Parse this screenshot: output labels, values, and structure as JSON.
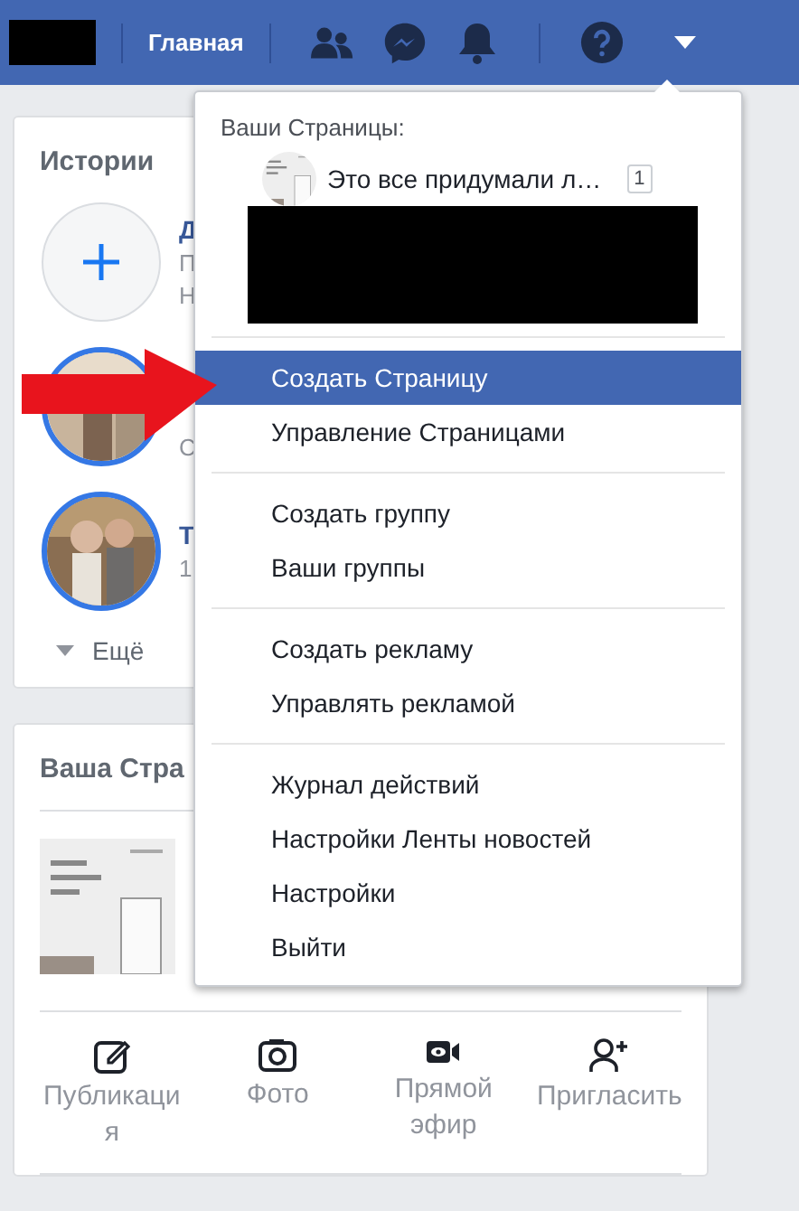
{
  "top_bar": {
    "home": "Главная",
    "menu_open": true
  },
  "stories": {
    "title": "Истории",
    "items": [
      {
        "kind": "add",
        "title": "Д",
        "lines": [
          "П",
          "Н"
        ]
      },
      {
        "kind": "story",
        "lines": [
          "С"
        ]
      },
      {
        "kind": "story",
        "title": "Т",
        "lines": [
          "1"
        ]
      }
    ],
    "more": "Ещё"
  },
  "your_page": {
    "title": "Ваша Стра",
    "actions": [
      {
        "kind": "post",
        "label": "Публикация"
      },
      {
        "label": "Фото"
      },
      {
        "kind": "live",
        "label": "Прямой эфир"
      },
      {
        "kind": "invite",
        "label": "Пригласить"
      }
    ]
  },
  "dropdown": {
    "header": "Ваши Страницы:",
    "page": {
      "name": "Это все придумали л…",
      "badge": "1"
    },
    "sections": [
      {
        "items": [
          {
            "label": "Создать Страницу",
            "selected": true
          },
          {
            "label": "Управление Страницами",
            "selected": false
          }
        ]
      },
      {
        "items": [
          {
            "label": "Создать группу",
            "selected": false
          },
          {
            "label": "Ваши группы",
            "selected": false
          }
        ]
      },
      {
        "items": [
          {
            "label": "Создать рекламу",
            "selected": false
          },
          {
            "label": "Управлять рекламой",
            "selected": false
          }
        ]
      },
      {
        "items": [
          {
            "label": "Журнал действий",
            "selected": false
          },
          {
            "label": "Настройки Ленты новостей",
            "selected": false
          },
          {
            "label": "Настройки",
            "selected": false
          },
          {
            "label": "Выйти",
            "selected": false
          }
        ]
      }
    ]
  }
}
